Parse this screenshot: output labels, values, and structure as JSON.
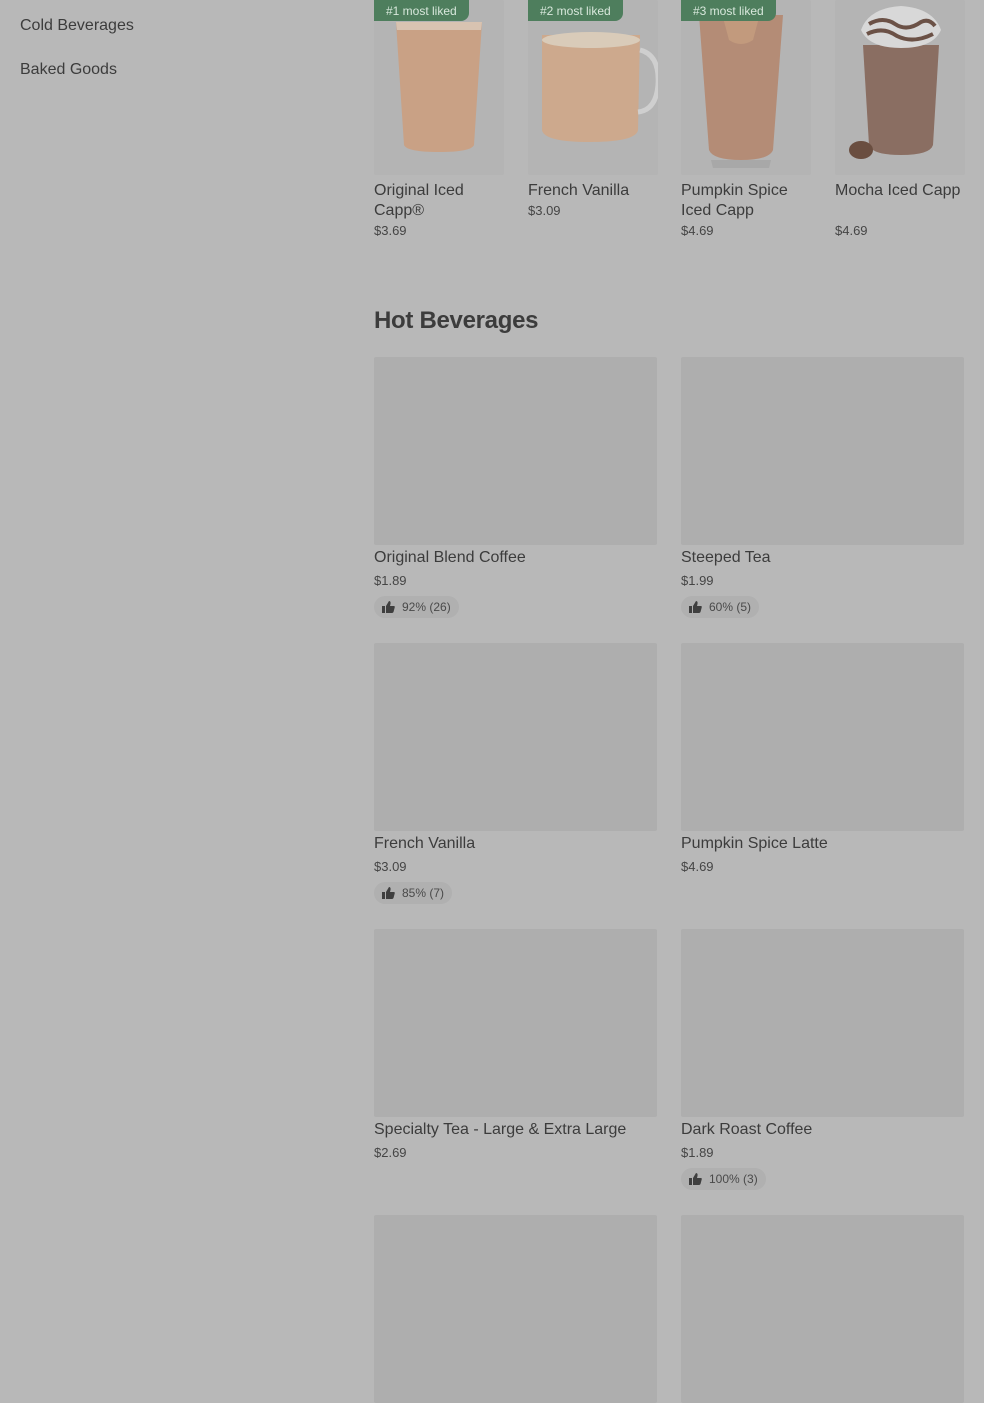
{
  "sidebar": {
    "items": [
      {
        "label": "Cold Beverages"
      },
      {
        "label": "Baked Goods"
      }
    ]
  },
  "top_row": [
    {
      "badge": "#1 most liked",
      "name": "Original Iced Capp®",
      "price": "$3.69"
    },
    {
      "badge": "#2 most liked",
      "name": "French Vanilla",
      "price": "$3.09"
    },
    {
      "badge": "#3 most liked",
      "name": "Pumpkin Spice Iced Capp",
      "price": "$4.69"
    },
    {
      "badge": "",
      "name": "Mocha Iced Capp",
      "price": "$4.69"
    }
  ],
  "hot": {
    "title": "Hot Beverages",
    "items": [
      {
        "name": "Original Blend Coffee",
        "price": "$1.89",
        "rating": "92% (26)"
      },
      {
        "name": "Steeped Tea",
        "price": "$1.99",
        "rating": "60% (5)"
      },
      {
        "name": "French Vanilla",
        "price": "$3.09",
        "rating": "85% (7)"
      },
      {
        "name": "Pumpkin Spice Latte",
        "price": "$4.69",
        "rating": ""
      },
      {
        "name": "Specialty Tea - Large & Extra Large",
        "price": "$2.69",
        "rating": ""
      },
      {
        "name": "Dark Roast Coffee",
        "price": "$1.89",
        "rating": "100% (3)"
      }
    ]
  },
  "icons": {
    "thumb": "thumbs-up-icon"
  },
  "colors": {
    "badge_bg": "#4e7e5d",
    "overlay": "#b8b8b8"
  }
}
